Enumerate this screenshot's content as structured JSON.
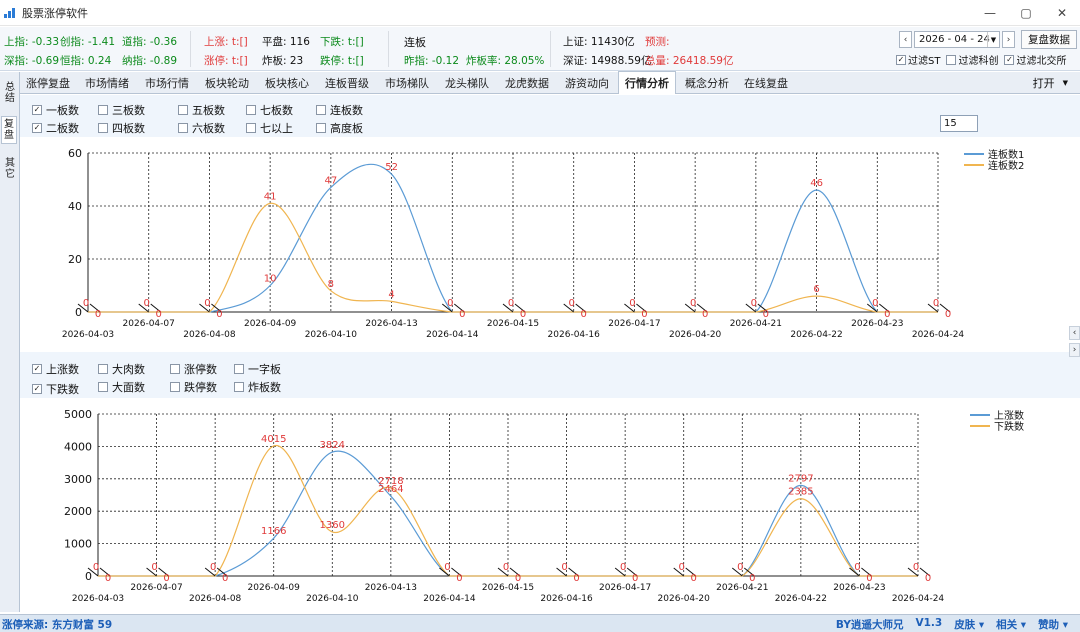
{
  "window": {
    "title": "股票涨停软件"
  },
  "infobar": {
    "shangzhi": "上指: -0.33",
    "chuangzhi": "创指: -1.41",
    "daozhi": "道指: -0.36",
    "shenzhi": "深指: -0.69",
    "hengzhi": "恒指: 0.24",
    "nazhi": "纳指: -0.89",
    "shangzhang": "上涨: t:[]",
    "pingpan": "平盘: 116",
    "xiadie": "下跌: t:[]",
    "zhangting": "涨停: t:[]",
    "zhaban": "炸板: 23",
    "dieting": "跌停: t:[]",
    "lianban": "连板",
    "zuozhi": "昨指: -0.12",
    "zhabanlv": "炸板率: 28.05%",
    "shz_amount": "上证: 11430亿",
    "yuce": "预测:",
    "sz_amount": "深证: 14988.59亿",
    "zongliang": "总量: 26418.59亿",
    "date": "2026 - 04 - 24",
    "review_btn": "复盘数据",
    "filters": [
      {
        "label": "过滤ST",
        "checked": "✓"
      },
      {
        "label": "过滤科创",
        "checked": ""
      },
      {
        "label": "过滤北交所",
        "checked": "✓"
      }
    ]
  },
  "tabs": [
    "涨停复盘",
    "市场情绪",
    "市场行情",
    "板块轮动",
    "板块核心",
    "连板晋级",
    "市场梯队",
    "龙头梯队",
    "龙虎数据",
    "游资动向",
    "行情分析",
    "概念分析",
    "在线复盘"
  ],
  "open_label": "打开",
  "left_tabs": [
    "总结",
    "复盘",
    "其它"
  ],
  "top_options": [
    {
      "label": "一板数",
      "checked": "✓"
    },
    {
      "label": "三板数",
      "checked": ""
    },
    {
      "label": "五板数",
      "checked": ""
    },
    {
      "label": "七板数",
      "checked": ""
    },
    {
      "label": "连板数",
      "checked": ""
    },
    {
      "label": "二板数",
      "checked": "✓"
    },
    {
      "label": "四板数",
      "checked": ""
    },
    {
      "label": "六板数",
      "checked": ""
    },
    {
      "label": "七以上",
      "checked": ""
    },
    {
      "label": "高度板",
      "checked": ""
    }
  ],
  "days_input": "15",
  "bottom_options": [
    {
      "label": "上涨数",
      "checked": "✓"
    },
    {
      "label": "大肉数",
      "checked": ""
    },
    {
      "label": "涨停数",
      "checked": ""
    },
    {
      "label": "一字板",
      "checked": ""
    },
    {
      "label": "下跌数",
      "checked": "✓"
    },
    {
      "label": "大面数",
      "checked": ""
    },
    {
      "label": "跌停数",
      "checked": ""
    },
    {
      "label": "炸板数",
      "checked": ""
    }
  ],
  "status": {
    "source": "涨停来源: 东方财富  59",
    "author": "BY逍遥大师兄",
    "version": "V1.3",
    "skin": "皮肤 ▾",
    "related": "相关 ▾",
    "support": "赞助 ▾"
  },
  "colors": {
    "series1": "#5b9bd5",
    "series2": "#f0b550",
    "label": "#e03a3a"
  },
  "chart_data": [
    {
      "type": "line",
      "categories": [
        "2026-04-03",
        "2026-04-07",
        "2026-04-08",
        "2026-04-09",
        "2026-04-10",
        "2026-04-13",
        "2026-04-14",
        "2026-04-15",
        "2026-04-16",
        "2026-04-17",
        "2026-04-20",
        "2026-04-21",
        "2026-04-22",
        "2026-04-23",
        "2026-04-24"
      ],
      "series": [
        {
          "name": "连板数1",
          "values": [
            0,
            0,
            0,
            10,
            47,
            52,
            0,
            0,
            0,
            0,
            0,
            0,
            46,
            0,
            0
          ]
        },
        {
          "name": "连板数2",
          "values": [
            0,
            0,
            0,
            41,
            8,
            4,
            0,
            0,
            0,
            0,
            0,
            0,
            6,
            0,
            0
          ]
        }
      ],
      "ylim": [
        0,
        60
      ],
      "yticks": [
        0,
        20,
        40,
        60
      ],
      "grid": true,
      "legend": "top-right"
    },
    {
      "type": "line",
      "categories": [
        "2026-04-03",
        "2026-04-07",
        "2026-04-08",
        "2026-04-09",
        "2026-04-10",
        "2026-04-13",
        "2026-04-14",
        "2026-04-15",
        "2026-04-16",
        "2026-04-17",
        "2026-04-20",
        "2026-04-21",
        "2026-04-22",
        "2026-04-23",
        "2026-04-24"
      ],
      "series": [
        {
          "name": "上涨数",
          "values": [
            0,
            0,
            0,
            1166,
            3824,
            2464,
            0,
            0,
            0,
            0,
            0,
            0,
            2797,
            0,
            0
          ]
        },
        {
          "name": "下跌数",
          "values": [
            0,
            0,
            0,
            4015,
            1360,
            2718,
            0,
            0,
            0,
            0,
            0,
            0,
            2385,
            0,
            0
          ]
        }
      ],
      "ylim": [
        0,
        5000
      ],
      "yticks": [
        0,
        1000,
        2000,
        3000,
        4000,
        5000
      ],
      "grid": true,
      "legend": "top-right"
    }
  ]
}
